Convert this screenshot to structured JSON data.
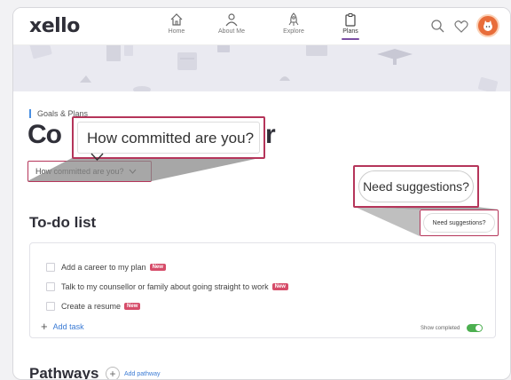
{
  "app": {
    "logo": "xello"
  },
  "nav": {
    "items": [
      {
        "label": "Home",
        "icon": "home-icon"
      },
      {
        "label": "About Me",
        "icon": "person-icon"
      },
      {
        "label": "Explore",
        "icon": "rocket-icon"
      },
      {
        "label": "Plans",
        "icon": "clipboard-icon",
        "active": true
      }
    ]
  },
  "header": {
    "search_icon": "search-icon",
    "favorites_icon": "heart-icon",
    "avatar_icon": "avatar-icon"
  },
  "page": {
    "breadcrumb": "Goals & Plans",
    "title_start": "Co",
    "title_end": "r",
    "commitment_select": "How committed are you?",
    "commitment_select_zoom": "How committed are you?",
    "suggestions_button": "Need suggestions?",
    "suggestions_button_zoom": "Need suggestions?"
  },
  "todo": {
    "title": "To-do list",
    "items": [
      {
        "label": "Add a career to my plan",
        "badge": "New"
      },
      {
        "label": "Talk to my counsellor or family about going straight to work",
        "badge": "New"
      },
      {
        "label": "Create a resume",
        "badge": "New"
      }
    ],
    "add_task": "Add task",
    "show_completed": "Show completed",
    "show_completed_on": true
  },
  "pathways": {
    "title": "Pathways",
    "add_label": "Add pathway"
  },
  "colors": {
    "highlight": "#b5355a",
    "accent": "#7b4fa3",
    "link": "#3b7bd4",
    "badge": "#d64d6a",
    "toggle": "#4caf50",
    "avatar": "#e86d3a"
  }
}
